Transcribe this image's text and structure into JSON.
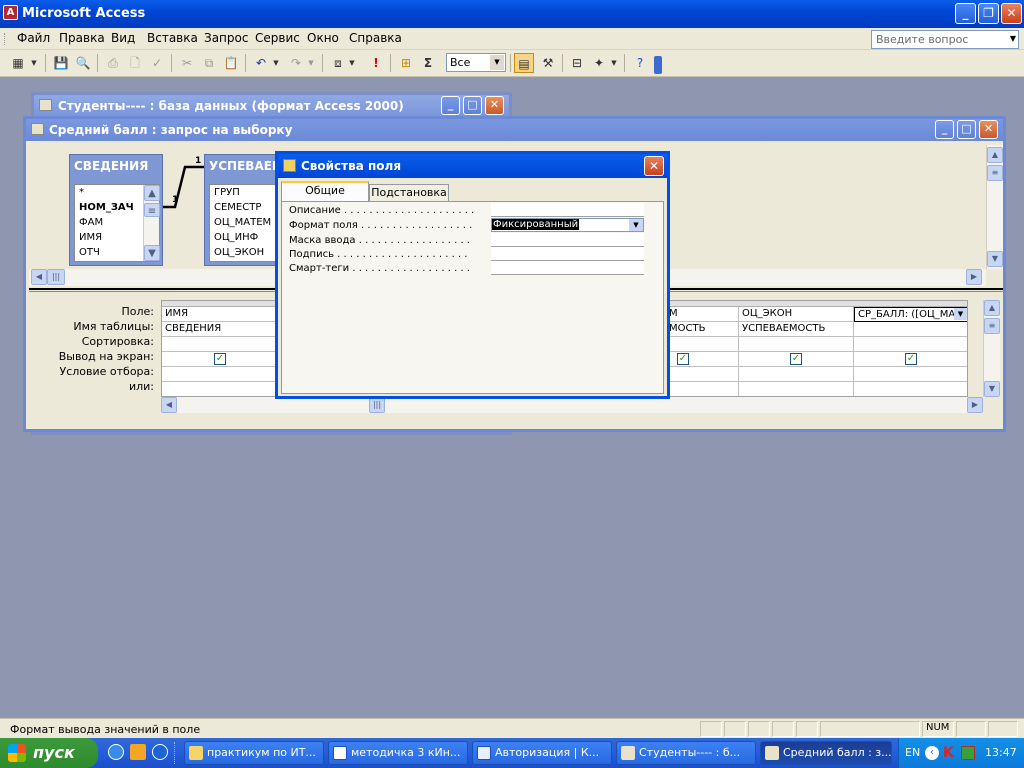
{
  "app": {
    "title": "Microsoft Access",
    "icon": "access-icon",
    "menu": [
      "Файл",
      "Правка",
      "Вид",
      "Вставка",
      "Запрос",
      "Сервис",
      "Окно",
      "Справка"
    ],
    "question_placeholder": "Введите вопрос",
    "toolbar_combo_value": "Все"
  },
  "db_window": {
    "title": "Студенты---- : база данных (формат Access 2000)"
  },
  "query_window": {
    "title": "Средний балл : запрос на выборку",
    "tables": [
      {
        "name": "СВЕДЕНИЯ",
        "fields": [
          "*",
          "НОМ_ЗАЧ",
          "ФАМ",
          "ИМЯ",
          "ОТЧ"
        ],
        "key_field": "НОМ_ЗАЧ"
      },
      {
        "name": "УСПЕВАЕМ",
        "fields": [
          "ГРУП",
          "СЕМЕСТР",
          "ОЦ_МАТЕМ",
          "ОЦ_ИНФ",
          "ОЦ_ЭКОН"
        ]
      }
    ],
    "relation_labels": {
      "left": "1",
      "right": "1"
    },
    "grid_row_labels": [
      "Поле:",
      "Имя таблицы:",
      "Сортировка:",
      "Вывод на экран:",
      "Условие отбора:",
      "или:"
    ],
    "columns": [
      {
        "field": "ИМЯ",
        "table": "СВЕДЕНИЯ",
        "show": true
      },
      {
        "field": "М",
        "table": "МОСТЬ",
        "show": true
      },
      {
        "field": "ОЦ_ЭКОН",
        "table": "УСПЕВАЕМОСТЬ",
        "show": true
      },
      {
        "field": "СР_БАЛЛ: ([ОЦ_МА",
        "table": "",
        "show": true
      }
    ]
  },
  "dialog": {
    "title": "Свойства поля",
    "tabs": [
      "Общие",
      "Подстановка"
    ],
    "active_tab": "Общие",
    "properties": [
      {
        "label": "Описание . . . . . . . . . . . . . . . . . . . . .",
        "value": ""
      },
      {
        "label": "Формат поля . . . . . . . . . . . . . . . . . .",
        "value": "Фиксированный"
      },
      {
        "label": "Маска ввода . . . . . . . . . . . . . . . . . .",
        "value": ""
      },
      {
        "label": "Подпись . . . . . . . . . . . . . . . . . . . . .",
        "value": ""
      },
      {
        "label": "Смарт-теги . . . . . . . . . . . . . . . . . . .",
        "value": ""
      }
    ]
  },
  "status": {
    "text": "Формат вывода значений в поле",
    "num": "NUM"
  },
  "taskbar": {
    "start_label": "пуск",
    "tasks": [
      "практикум по ИТ...",
      "методичка 3 кИн...",
      "Авторизация | К...",
      "Студенты---- : б...",
      "Средний балл : з..."
    ],
    "active_task": 4,
    "lang": "EN",
    "clock": "13:47"
  }
}
